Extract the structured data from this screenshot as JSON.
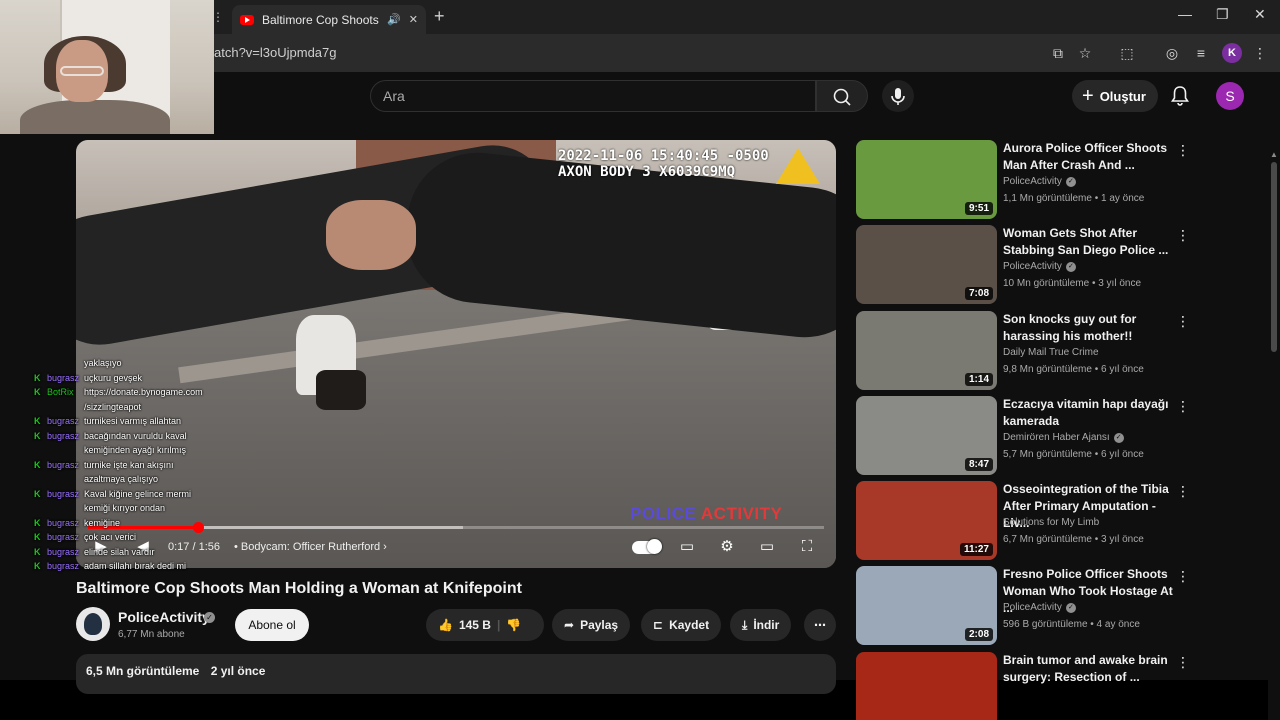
{
  "browser": {
    "tab_title": "Baltimore Cop Shoots Man",
    "url": "atch?v=l3oUjpmda7g",
    "profile_letter": "K"
  },
  "header": {
    "search_placeholder": "Ara",
    "create_label": "Oluştur",
    "avatar_letter": "S"
  },
  "video": {
    "timestamp_line1": "2022-11-06 15:40:45 -0500",
    "timestamp_line2": "AXON BODY 3 X6039C9MQ",
    "watermark_a": "POLICE",
    "watermark_b": "ACTIVITY",
    "time": "0:17 / 1:56",
    "chapter": "Bodycam: Officer Rutherford",
    "progress_fraction": 0.15,
    "buffer_fraction": 0.51,
    "title": "Baltimore Cop Shoots Man Holding a Woman at Knifepoint"
  },
  "channel": {
    "name": "PoliceActivity",
    "subscribers": "6,77 Mn abone",
    "subscribe_label": "Abone ol"
  },
  "actions": {
    "likes": "145 B",
    "share": "Paylaş",
    "save": "Kaydet",
    "download": "İndir"
  },
  "description": {
    "views": "6,5 Mn görüntüleme",
    "age": "2 yıl önce"
  },
  "chat": [
    {
      "user": "",
      "msg": "yaklaşıyo",
      "bot": false,
      "badge": false
    },
    {
      "user": "bugrasz",
      "msg": "uçkuru gevşek",
      "bot": false,
      "badge": true
    },
    {
      "user": "BotRix",
      "msg": "https://donate.bynogame.com",
      "bot": true,
      "badge": true
    },
    {
      "user": "",
      "msg": "/sizzlingteapot",
      "bot": false,
      "badge": false
    },
    {
      "user": "bugrasz",
      "msg": "turnikesi varmış allahtan",
      "bot": false,
      "badge": true
    },
    {
      "user": "bugrasz",
      "msg": "bacağından vuruldu kaval",
      "bot": false,
      "badge": true
    },
    {
      "user": "",
      "msg": "kemiğinden ayağı kırılmış",
      "bot": false,
      "badge": false
    },
    {
      "user": "bugrasz",
      "msg": "turnike işte kan akışını",
      "bot": false,
      "badge": true
    },
    {
      "user": "",
      "msg": "azaltmaya çalışıyo",
      "bot": false,
      "badge": false
    },
    {
      "user": "bugrasz",
      "msg": "Kaval kiğine gelince mermi",
      "bot": false,
      "badge": true
    },
    {
      "user": "",
      "msg": "kemiği kırıyor ondan",
      "bot": false,
      "badge": false
    },
    {
      "user": "bugrasz",
      "msg": "kemiğine",
      "bot": false,
      "badge": true
    },
    {
      "user": "bugrasz",
      "msg": "çok acı verici",
      "bot": false,
      "badge": true
    },
    {
      "user": "bugrasz",
      "msg": "elinde silah vardır",
      "bot": false,
      "badge": true
    },
    {
      "user": "bugrasz",
      "msg": "adam sillahı bırak dedi mi",
      "bot": false,
      "badge": true
    }
  ],
  "recommendations": [
    {
      "title": "Aurora Police Officer Shoots Man After Crash And ...",
      "channel": "PoliceActivity",
      "verified": true,
      "meta": "1,1 Mn görüntüleme • 1 ay önce",
      "duration": "9:51",
      "thumb_color": "#6a9a40"
    },
    {
      "title": "Woman Gets Shot After Stabbing San Diego Police ...",
      "channel": "PoliceActivity",
      "verified": true,
      "meta": "10 Mn görüntüleme • 3 yıl önce",
      "duration": "7:08",
      "thumb_color": "#5a5048"
    },
    {
      "title": "Son knocks guy out for harassing his mother!!",
      "channel": "Daily Mail True Crime",
      "verified": false,
      "meta": "9,8 Mn görüntüleme • 6 yıl önce",
      "duration": "1:14",
      "thumb_color": "#7a7a72"
    },
    {
      "title": "Eczacıya vitamin hapı dayağı kamerada",
      "channel": "Demirören Haber Ajansı",
      "verified": true,
      "meta": "5,7 Mn görüntüleme • 6 yıl önce",
      "duration": "8:47",
      "thumb_color": "#8a8a86"
    },
    {
      "title": "Osseointegration of the Tibia After Primary Amputation - Liv...",
      "channel": "Solutions for My Limb",
      "verified": false,
      "meta": "6,7 Mn görüntüleme • 3 yıl önce",
      "duration": "11:27",
      "thumb_color": "#a83828"
    },
    {
      "title": "Fresno Police Officer Shoots Woman Who Took Hostage At ...",
      "channel": "PoliceActivity",
      "verified": true,
      "meta": "596 B görüntüleme • 4 ay önce",
      "duration": "2:08",
      "thumb_color": "#9aa8b8"
    },
    {
      "title": "Brain tumor and awake brain surgery: Resection of ...",
      "channel": "",
      "verified": false,
      "meta": "",
      "duration": "",
      "thumb_color": "#a82818"
    }
  ]
}
